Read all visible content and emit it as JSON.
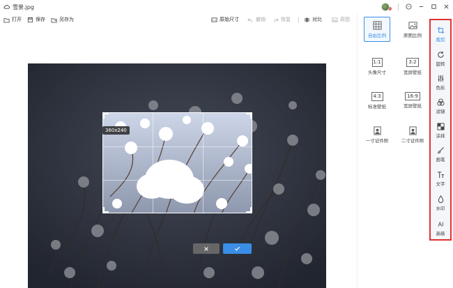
{
  "window": {
    "title": "雪景.jpg"
  },
  "toolbar": {
    "open": "打开",
    "save": "保存",
    "save_as": "另存为",
    "original_size": "原始尺寸",
    "undo": "撤销",
    "redo": "恢复",
    "compare": "对比",
    "original_image": "原图"
  },
  "canvas": {
    "crop_size_label": "360x240"
  },
  "ratios": [
    {
      "glyph": "",
      "label": "自由比例",
      "selected": true
    },
    {
      "glyph": "",
      "label": "原图比例",
      "selected": false
    },
    {
      "glyph": "1:1",
      "label": "头像尺寸",
      "selected": false
    },
    {
      "glyph": "3:2",
      "label": "宽屏壁纸",
      "selected": false
    },
    {
      "glyph": "4:3",
      "label": "标准壁纸",
      "selected": false
    },
    {
      "glyph": "16:9",
      "label": "宽屏壁纸",
      "selected": false
    },
    {
      "glyph": "",
      "label": "一寸证件照",
      "selected": false
    },
    {
      "glyph": "",
      "label": "二寸证件照",
      "selected": false
    }
  ],
  "tools": [
    {
      "label": "裁剪",
      "icon": "crop-icon",
      "active": true
    },
    {
      "label": "旋转",
      "icon": "rotate-icon",
      "active": false
    },
    {
      "label": "色彩",
      "icon": "adjust-sliders-icon",
      "active": false
    },
    {
      "label": "滤镜",
      "icon": "filter-circles-icon",
      "active": false
    },
    {
      "label": "涂抹",
      "icon": "mosaic-icon",
      "active": false
    },
    {
      "label": "画笔",
      "icon": "brush-icon",
      "active": false
    },
    {
      "label": "文字",
      "icon": "text-icon",
      "active": false
    },
    {
      "label": "水印",
      "icon": "watermark-icon",
      "active": false
    },
    {
      "label": "高级",
      "icon": "ai-icon",
      "active": false
    }
  ],
  "colors": {
    "accent": "#3a8ee6",
    "highlight_border": "#e03131"
  }
}
